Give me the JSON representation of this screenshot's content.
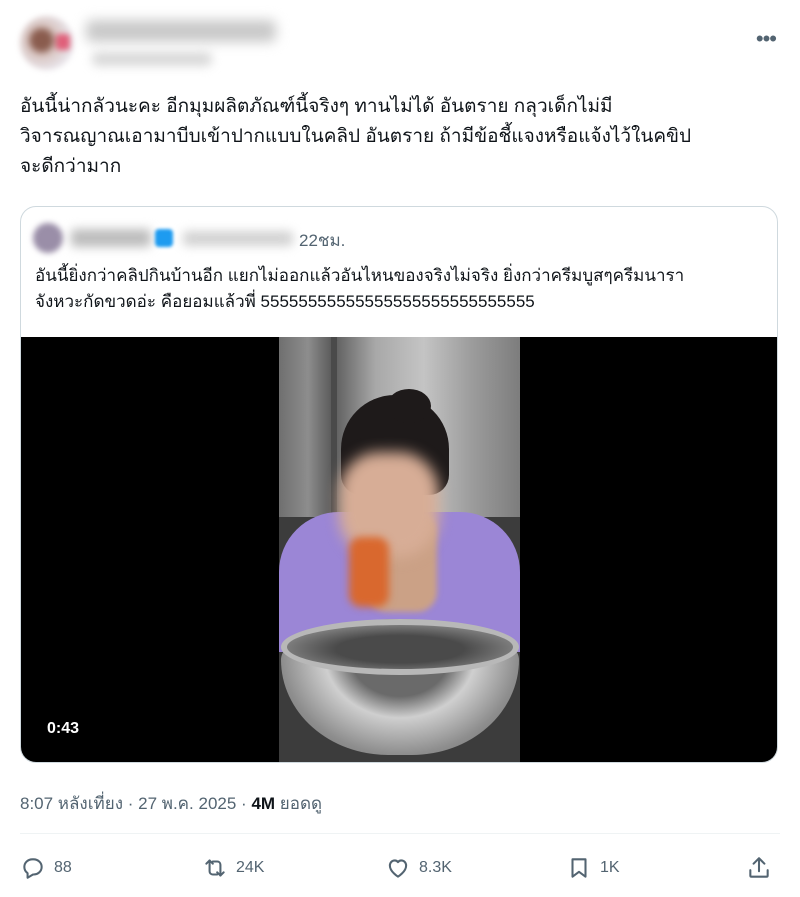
{
  "post": {
    "text": "อันนี้น่ากลัวนะคะ อีกมุมผลิตภัณฑ์นี้จริงๆ ทานไม่ได้ อันตราย กลุวเด็กไม่มี\nวิจารณญาณเอามาบีบเข้าปากแบบในคลิป อันตราย ถ้ามีข้อชี้แจงหรือแจ้งไว้ในคขิป\nจะดีกว่ามาก"
  },
  "quoted": {
    "time": "22ชม.",
    "text": "อันนี้ยิ่งกว่าคลิปกินบ้านอีก แยกไม่ออกแล้วอันไหนของจริงไม่จริง ยิ่งกว่าครีมบูสๆครีมนารา\nจังหวะกัดขวดอ่ะ คือยอมแล้วพี่ 55555555555555555555555555555",
    "video_duration": "0:43"
  },
  "meta": {
    "time_date": "8:07 หลังเที่ยง · 27 พ.ค. 2025 · ",
    "views": "4M",
    "views_label": " ยอดดู"
  },
  "actions": {
    "replies": "88",
    "reposts": "24K",
    "likes": "8.3K",
    "bookmarks": "1K"
  },
  "icons": [
    "more-icon",
    "reply-icon",
    "repost-icon",
    "like-icon",
    "bookmark-icon",
    "share-icon"
  ],
  "colors": {
    "secondary_text": "#536471",
    "border": "#cfd9de",
    "verified": "#1d9bf0"
  }
}
